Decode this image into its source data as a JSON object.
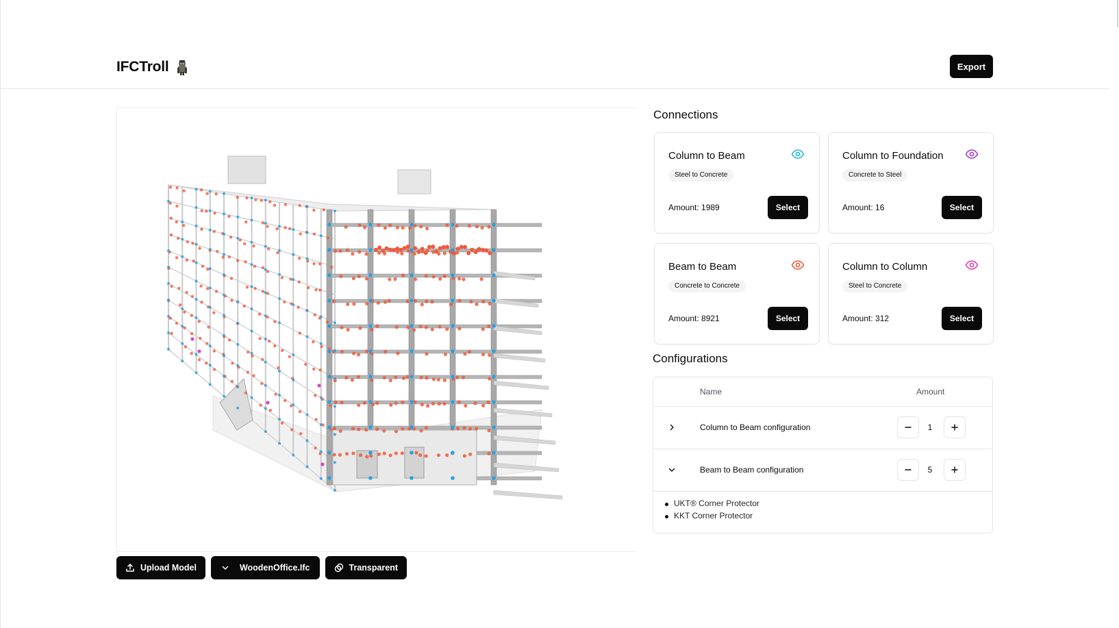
{
  "app": {
    "title": "IFCTroll",
    "logo_icon": "troll-icon"
  },
  "header": {
    "export_label": "Export"
  },
  "viewer": {
    "upload_label": "Upload Model",
    "model_select_value": "WoodenOffice.Ifc",
    "transparent_label": "Transparent"
  },
  "connections": {
    "title": "Connections",
    "cards": [
      {
        "title": "Column to Beam",
        "badge": "Steel to Concrete",
        "amount_text": "Amount: 1989",
        "select_label": "Select",
        "eye_color": "#22b8d6"
      },
      {
        "title": "Column to Foundation",
        "badge": "Concrete to Steel",
        "amount_text": "Amount: 16",
        "select_label": "Select",
        "eye_color": "#a03ccc"
      },
      {
        "title": "Beam to Beam",
        "badge": "Concrete to Concrete",
        "amount_text": "Amount: 8921",
        "select_label": "Select",
        "eye_color": "#ef5a3c"
      },
      {
        "title": "Column to Column",
        "badge": "Steel to Concrete",
        "amount_text": "Amount: 312",
        "select_label": "Select",
        "eye_color": "#e03cb4"
      }
    ]
  },
  "configurations": {
    "title": "Configurations",
    "columns": {
      "name": "Name",
      "amount": "Amount"
    },
    "rows": [
      {
        "name": "Column to Beam configuration",
        "amount": "1",
        "expanded": false
      },
      {
        "name": "Beam to Beam configuration",
        "amount": "5",
        "expanded": true
      }
    ],
    "products": [
      "UKT® Corner Protector",
      "KKT Corner Protector"
    ]
  },
  "colors": {
    "primary": "#0a0a0a",
    "connection_orange": "#ef5a3c",
    "connection_blue": "#2b9fe0",
    "connection_magenta": "#d14ac8"
  }
}
